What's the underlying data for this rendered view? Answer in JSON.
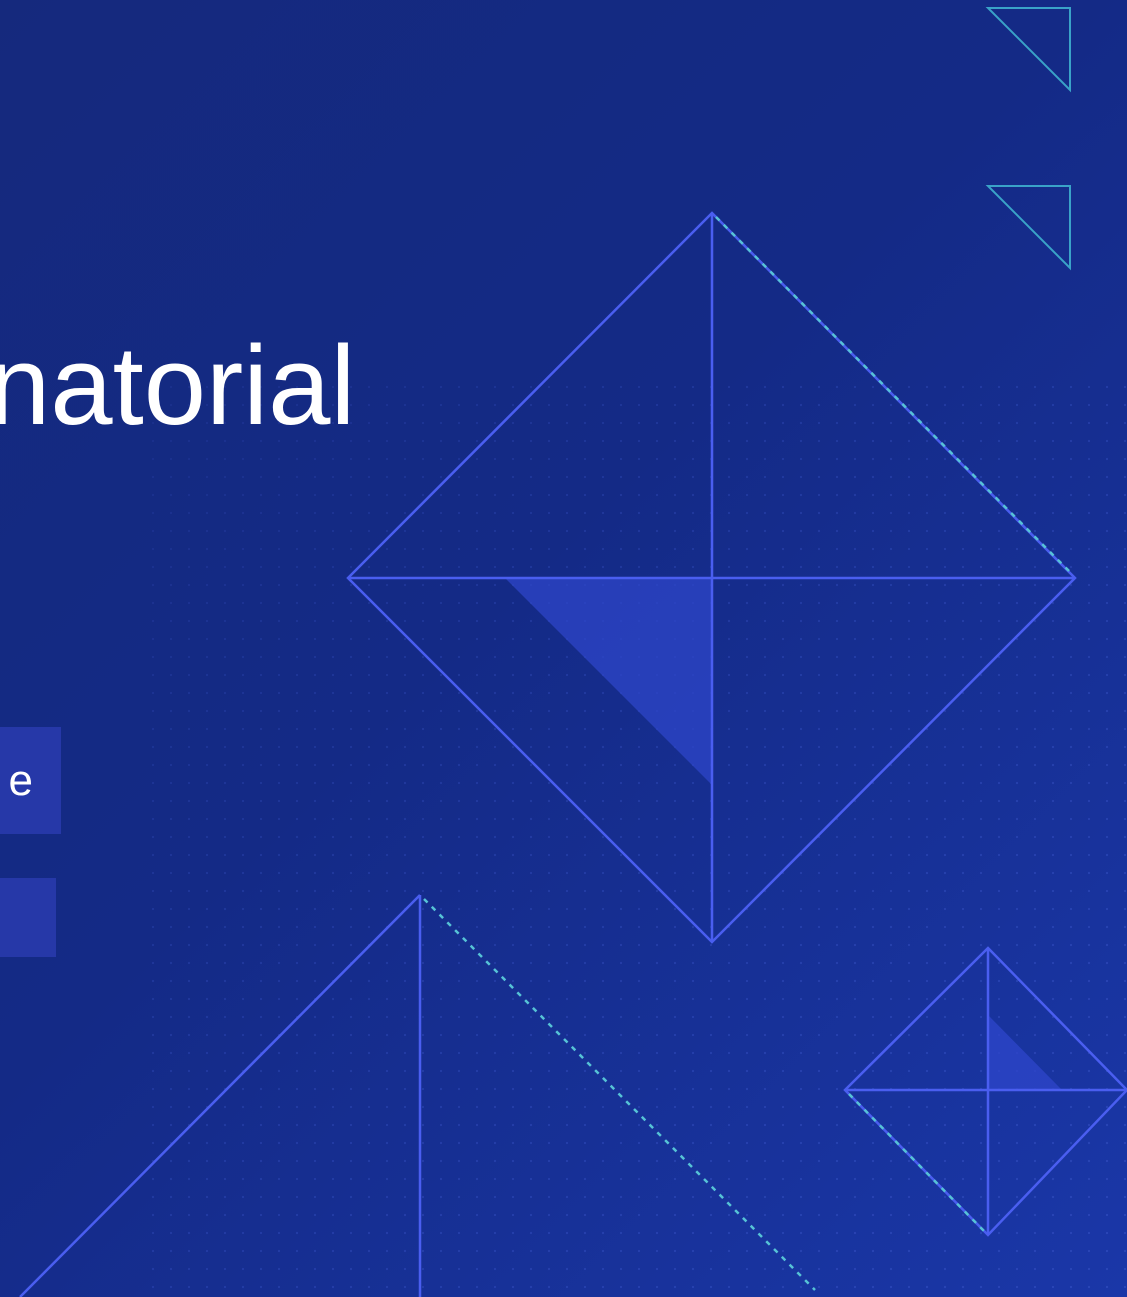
{
  "slide": {
    "title": "natorial",
    "tag_1": "e",
    "tag_2": ""
  },
  "colors": {
    "background": "#142a86",
    "line": "#4a5ef0",
    "dashed_accent": "#56c3d6",
    "tag_fill": "#2638a8",
    "text": "#ffffff"
  }
}
